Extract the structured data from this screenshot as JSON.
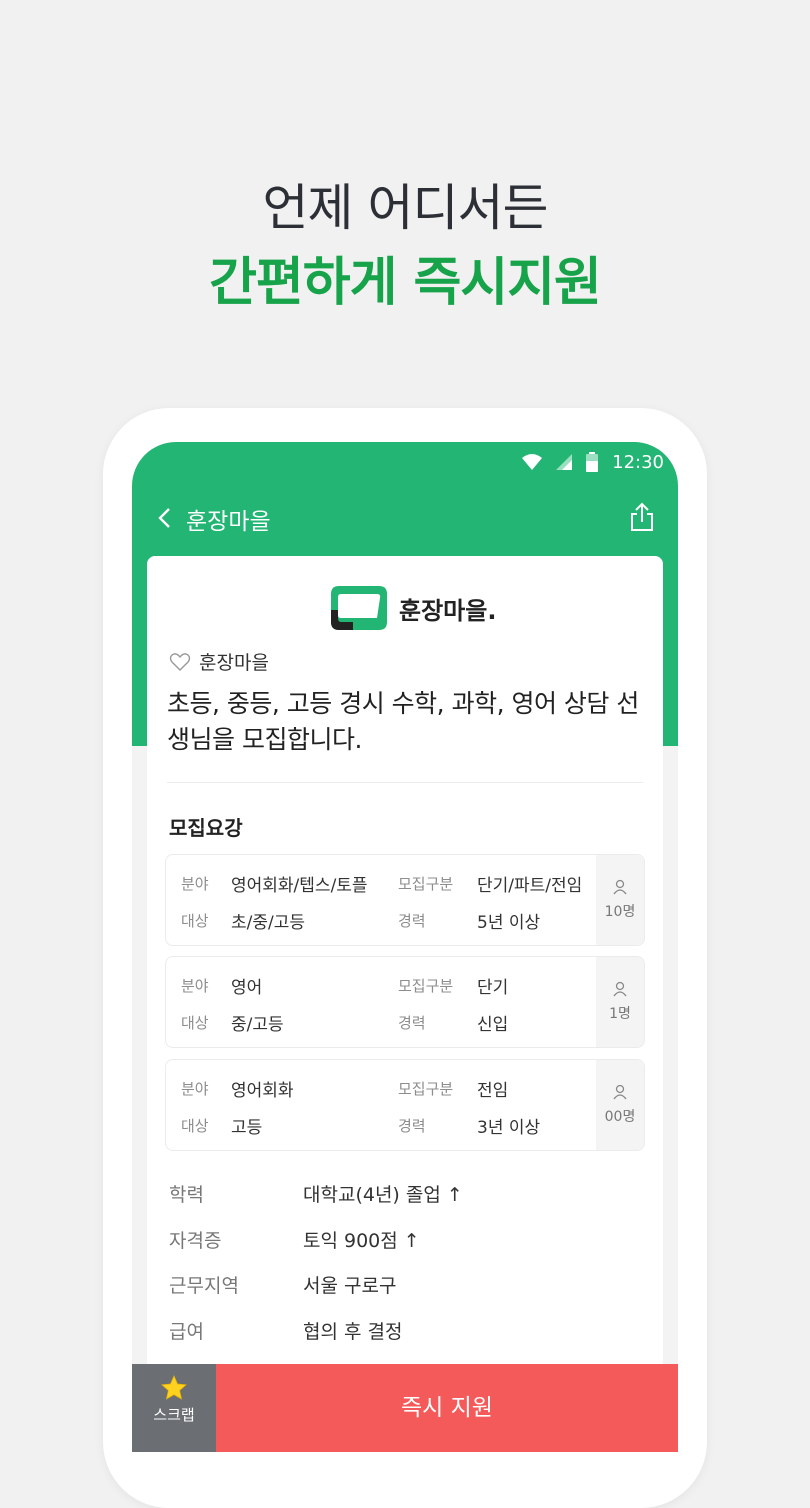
{
  "promo": {
    "line1": "언제 어디서든",
    "line2": "간편하게 즉시지원"
  },
  "status_bar": {
    "time": "12:30"
  },
  "appbar": {
    "title": "훈장마을"
  },
  "logo": {
    "text": "훈장마을."
  },
  "company": {
    "name": "훈장마을"
  },
  "job": {
    "title": "초등, 중등, 고등 경시 수학, 과학, 영어 상담 선생님을 모집합니다."
  },
  "requirements": {
    "section_title": "모집요강",
    "labels": {
      "field": "분야",
      "target": "대상",
      "type": "모집구분",
      "career": "경력"
    },
    "items": [
      {
        "field": "영어회화/텝스/토플",
        "target": "초/중/고등",
        "type": "단기/파트/전임",
        "career": "5년 이상",
        "count": "10명"
      },
      {
        "field": "영어",
        "target": "중/고등",
        "type": "단기",
        "career": "신입",
        "count": "1명"
      },
      {
        "field": "영어회화",
        "target": "고등",
        "type": "전임",
        "career": "3년 이상",
        "count": "00명"
      }
    ]
  },
  "details": [
    {
      "key": "학력",
      "value": "대학교(4년) 졸업 ↑"
    },
    {
      "key": "자격증",
      "value": "토익 900점 ↑"
    },
    {
      "key": "근무지역",
      "value": "서울 구로구"
    },
    {
      "key": "급여",
      "value": "협의 후 결정"
    }
  ],
  "bottom": {
    "scrap_label": "스크랩",
    "apply_label": "즉시 지원"
  },
  "colors": {
    "brand_green": "#22b573",
    "headline_green": "#16a34a",
    "apply_red": "#f55a5a",
    "scrap_gray": "#6b6e73"
  },
  "icons": [
    "wifi-icon",
    "signal-icon",
    "battery-icon",
    "back-arrow-icon",
    "share-icon",
    "heart-icon",
    "person-icon",
    "star-icon"
  ]
}
